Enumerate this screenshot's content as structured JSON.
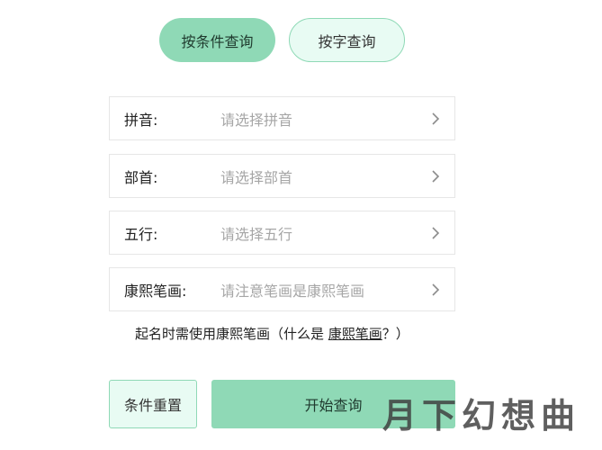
{
  "tabs": {
    "by_condition": "按条件查询",
    "by_character": "按字查询"
  },
  "fields": [
    {
      "label": "拼音:",
      "placeholder": "请选择拼音"
    },
    {
      "label": "部首:",
      "placeholder": "请选择部首"
    },
    {
      "label": "五行:",
      "placeholder": "请选择五行"
    },
    {
      "label": "康熙笔画:",
      "placeholder": "请注意笔画是康熙笔画"
    }
  ],
  "note": {
    "prefix": "起名时需使用康熙笔画（什么是 ",
    "link": "康熙笔画",
    "suffix": "？）"
  },
  "buttons": {
    "reset": "条件重置",
    "search": "开始查询"
  },
  "watermark": "月下幻想曲",
  "colors": {
    "accent": "#8fd9b6",
    "accent_light": "#e8fbf3",
    "placeholder": "#a6a6a6"
  }
}
